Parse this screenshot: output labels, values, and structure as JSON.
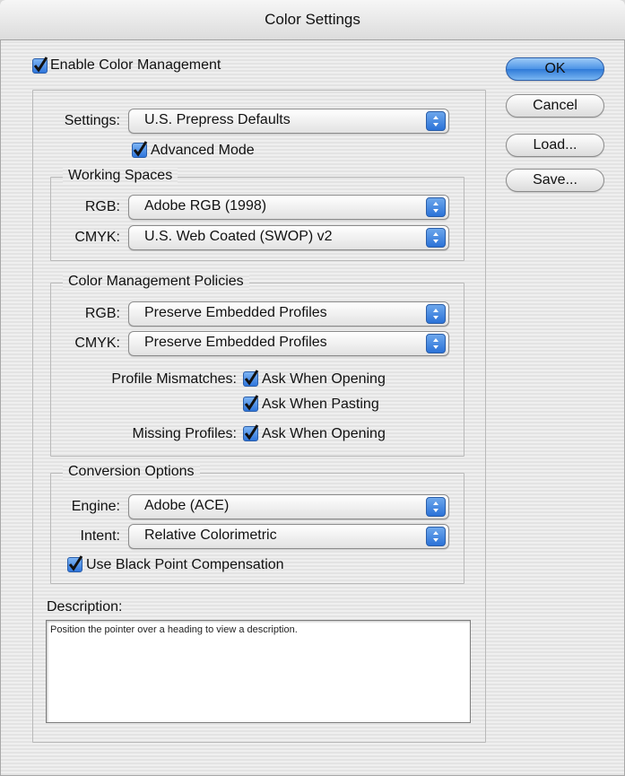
{
  "window": {
    "title": "Color Settings"
  },
  "enable_color_management": {
    "label": "Enable Color Management",
    "checked": true
  },
  "buttons": {
    "ok": "OK",
    "cancel": "Cancel",
    "load": "Load...",
    "save": "Save..."
  },
  "settings": {
    "label": "Settings:",
    "value": "U.S. Prepress Defaults",
    "advanced_mode": {
      "label": "Advanced Mode",
      "checked": true
    }
  },
  "working_spaces": {
    "title": "Working Spaces",
    "rgb": {
      "label": "RGB:",
      "value": "Adobe RGB (1998)"
    },
    "cmyk": {
      "label": "CMYK:",
      "value": "U.S. Web Coated (SWOP) v2"
    }
  },
  "policies": {
    "title": "Color Management Policies",
    "rgb": {
      "label": "RGB:",
      "value": "Preserve Embedded Profiles"
    },
    "cmyk": {
      "label": "CMYK:",
      "value": "Preserve Embedded Profiles"
    },
    "profile_mismatches_label": "Profile Mismatches:",
    "ask_opening": {
      "label": "Ask When Opening",
      "checked": true
    },
    "ask_pasting": {
      "label": "Ask When Pasting",
      "checked": true
    },
    "missing_profiles_label": "Missing Profiles:",
    "missing_ask_opening": {
      "label": "Ask When Opening",
      "checked": true
    }
  },
  "conversion": {
    "title": "Conversion Options",
    "engine": {
      "label": "Engine:",
      "value": "Adobe (ACE)"
    },
    "intent": {
      "label": "Intent:",
      "value": "Relative Colorimetric"
    },
    "black_point": {
      "label": "Use Black Point Compensation",
      "checked": true
    }
  },
  "description": {
    "title": "Description:",
    "text": "Position the pointer over a heading to view a description."
  },
  "colors": {
    "accent": "#2f76dc",
    "window_bg": "#ececec"
  }
}
